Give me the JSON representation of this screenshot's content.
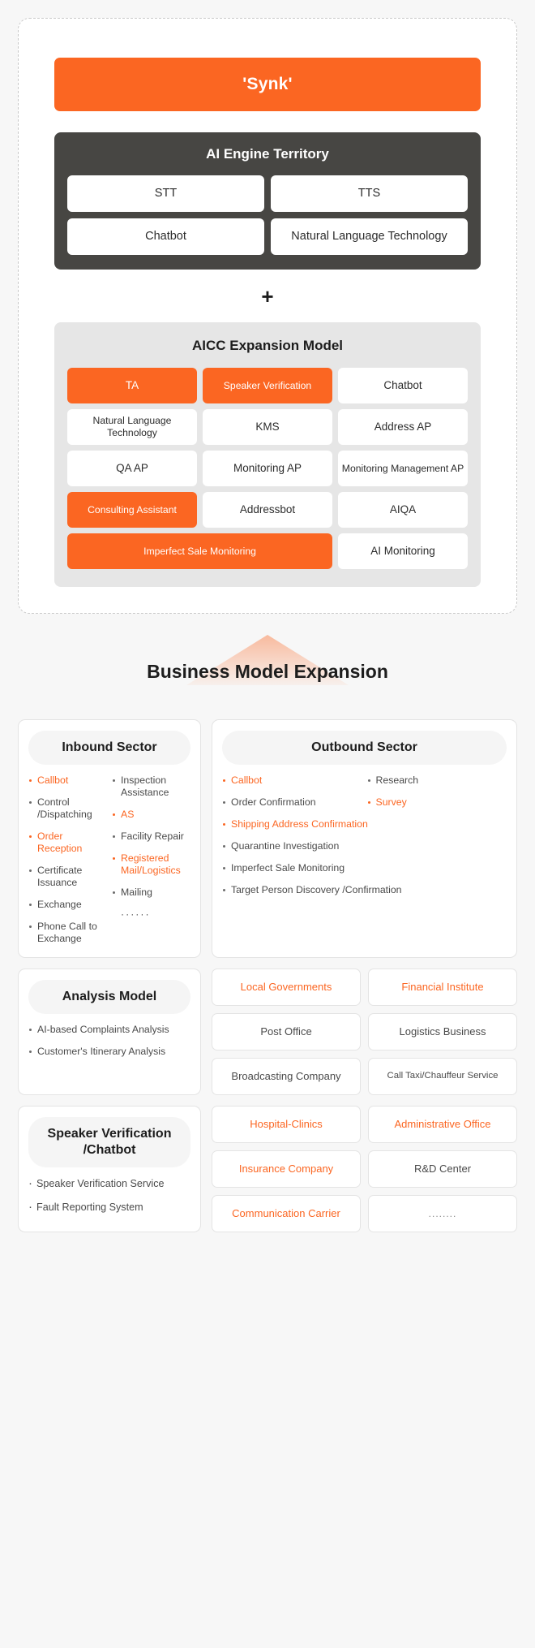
{
  "brand": {
    "accent": "#fb6622",
    "dark": "#474643",
    "grey_panel": "#e6e6e6"
  },
  "synk": {
    "label": "'Synk'"
  },
  "ai_engine": {
    "title": "AI Engine Territory",
    "cells": [
      "STT",
      "TTS",
      "Chatbot",
      "Natural Language Technology"
    ]
  },
  "plus": {
    "symbol": "+"
  },
  "aicc": {
    "title": "AICC Expansion Model",
    "cells": [
      {
        "label": "TA",
        "highlight": true
      },
      {
        "label": "Speaker Verification",
        "highlight": true
      },
      {
        "label": "Chatbot",
        "highlight": false
      },
      {
        "label": "Natural Language Technology",
        "highlight": false
      },
      {
        "label": "KMS",
        "highlight": false
      },
      {
        "label": "Address AP",
        "highlight": false
      },
      {
        "label": "QA AP",
        "highlight": false
      },
      {
        "label": "Monitoring AP",
        "highlight": false
      },
      {
        "label": "Monitoring Management AP",
        "highlight": false
      },
      {
        "label": "Consulting Assistant",
        "highlight": true
      },
      {
        "label": "Addressbot",
        "highlight": false
      },
      {
        "label": "AIQA",
        "highlight": false
      },
      {
        "label": "Imperfect Sale Monitoring",
        "highlight": true
      },
      {
        "label": "AI Monitoring",
        "highlight": false
      }
    ]
  },
  "bme": {
    "title": "Business Model Expansion"
  },
  "inbound": {
    "title": "Inbound Sector",
    "left": [
      {
        "label": "Callbot",
        "orange": true
      },
      {
        "label": "Control /Dispatching",
        "orange": false
      },
      {
        "label": "Order Reception",
        "orange": true
      },
      {
        "label": "Certificate Issuance",
        "orange": false
      },
      {
        "label": "Exchange",
        "orange": false
      },
      {
        "label": "Phone Call to Exchange",
        "orange": false
      }
    ],
    "right": [
      {
        "label": "Inspection Assistance",
        "orange": false
      },
      {
        "label": "AS",
        "orange": true
      },
      {
        "label": "Facility Repair",
        "orange": false
      },
      {
        "label": "Registered Mail/Logistics",
        "orange": true
      },
      {
        "label": "Mailing",
        "orange": false
      },
      {
        "label": "······",
        "orange": false,
        "nobullet": true
      }
    ]
  },
  "outbound": {
    "title": "Outbound Sector",
    "left": [
      {
        "label": "Callbot",
        "orange": true
      },
      {
        "label": "Order Confirmation",
        "orange": false
      }
    ],
    "right": [
      {
        "label": "Research",
        "orange": false
      },
      {
        "label": "Survey",
        "orange": true
      }
    ],
    "full": [
      {
        "label": "Shipping Address Confirmation",
        "orange": true
      },
      {
        "label": "Quarantine Investigation",
        "orange": false
      },
      {
        "label": "Imperfect Sale Monitoring",
        "orange": false
      },
      {
        "label": "Target Person Discovery /Confirmation",
        "orange": false
      }
    ]
  },
  "analysis": {
    "title": "Analysis Model",
    "items": [
      {
        "label": "AI-based Complaints Analysis"
      },
      {
        "label": "Customer's Itinerary Analysis"
      }
    ]
  },
  "industries_top": [
    {
      "label": "Local Governments",
      "orange": true,
      "tiny": false
    },
    {
      "label": "Financial Institute",
      "orange": true,
      "tiny": false
    },
    {
      "label": "Post Office",
      "orange": false,
      "tiny": false
    },
    {
      "label": "Logistics Business",
      "orange": false,
      "tiny": false
    },
    {
      "label": "Broadcasting Company",
      "orange": false,
      "tiny": false
    },
    {
      "label": "Call Taxi/Chauffeur Service",
      "orange": false,
      "tiny": true
    }
  ],
  "speaker_panel": {
    "title": "Speaker Verification /Chatbot",
    "items": [
      {
        "label": "Speaker Verification Service"
      },
      {
        "label": "Fault Reporting System"
      }
    ]
  },
  "industries_bottom": [
    {
      "label": "Hospital-Clinics",
      "orange": true,
      "tiny": false,
      "dots": false
    },
    {
      "label": "Administrative Office",
      "orange": true,
      "tiny": false,
      "dots": false
    },
    {
      "label": "Insurance Company",
      "orange": true,
      "tiny": false,
      "dots": false
    },
    {
      "label": "R&D Center",
      "orange": false,
      "tiny": false,
      "dots": false
    },
    {
      "label": "Communication Carrier",
      "orange": true,
      "tiny": false,
      "dots": false
    },
    {
      "label": "........",
      "orange": false,
      "tiny": false,
      "dots": true
    }
  ]
}
